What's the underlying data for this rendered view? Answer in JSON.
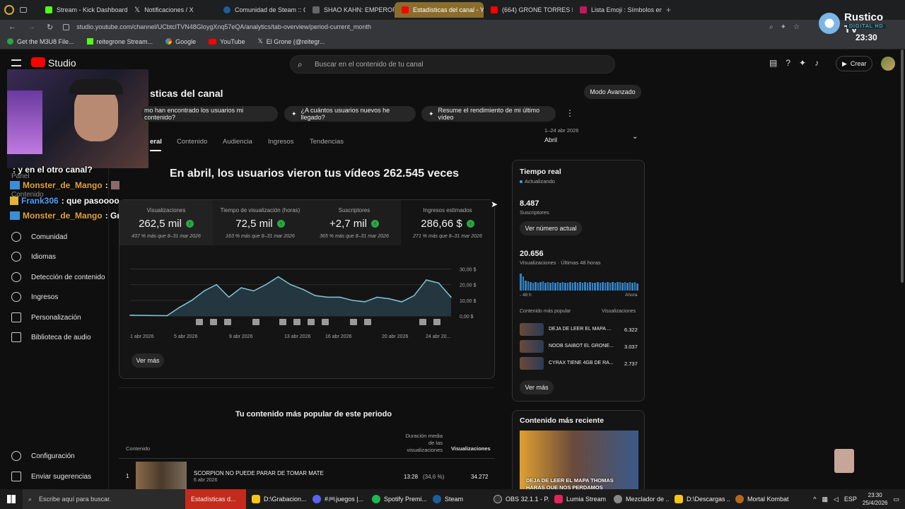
{
  "browser": {
    "tabs": [
      "Stream - Kick Dashboard",
      "Notificaciones / X",
      "Comunidad de Steam :: Gr",
      "SHAO KAHN: EMPEROR O",
      "Estadísticas del canal - Yo",
      "(664) GRONE TORRES DE",
      "Lista Emoji : Símbolos emo"
    ],
    "url": "studio.youtube.com/channel/UCbtclTVN48GloygXnq57eQA/analytics/tab-overview/period-current_month",
    "bookmarks": [
      "Get the M3U8 File...",
      "reitegrone Stream...",
      "Google",
      "YouTube",
      "El Grone (@reitegr..."
    ]
  },
  "overlay": {
    "brand": "Rustico TV",
    "brand_sub": "DIGITAL HD",
    "clock": "23:30"
  },
  "studio": {
    "logo": "Studio",
    "search_placeholder": "Buscar en el contenido de tu canal",
    "create": "Crear",
    "page_title": "sticas del canal",
    "advanced": "Modo Avanzado",
    "chips": [
      "mo han encontrado los usuarios mi contenido?",
      "¿A cuántos usuarios nuevos he llegado?",
      "Resume el rendimiento de mi último vídeo"
    ],
    "tabs": [
      "eral",
      "Contenido",
      "Audiencia",
      "Ingresos",
      "Tendencias"
    ],
    "date_range": "1–24 abr 2026",
    "date_label": "Abril",
    "headline": "En abril, los usuarios vieron tus vídeos 262.545 veces",
    "metrics": [
      {
        "label": "Visualizaciones",
        "value": "262,5 mil",
        "sub": "437 % más que 8–31 mar 2026"
      },
      {
        "label": "Tiempo de visualización (horas)",
        "value": "72,5 mil",
        "sub": "163 % más que 8–31 mar 2026"
      },
      {
        "label": "Suscriptores",
        "value": "+2,7 mil",
        "sub": "365 % más que 8–31 mar 2026"
      },
      {
        "label": "Ingresos estimados",
        "value": "286,66 $",
        "sub": "271 % más que 8–31 mar 2026"
      }
    ],
    "ver_mas": "Ver más",
    "popular_title": "Tu contenido más popular de este periodo",
    "table_headers": {
      "content": "Contenido",
      "avg": "Duración media de las visualizaciones",
      "views": "Visualizaciones"
    },
    "top_row": {
      "rank": "1",
      "title": "SCORPION NO PUEDE PARAR DE TOMAR MATE",
      "date": "6 abr 2026",
      "duration": "13:28",
      "pct": "(34,6 %)",
      "views": "34.272"
    }
  },
  "chart_data": {
    "type": "area",
    "x": [
      "1 abr 2026",
      "5 abr 2026",
      "9 abr 2026",
      "13 abr 2026",
      "16 abr 2026",
      "20 abr 2026",
      "24 abr 20..."
    ],
    "series": [
      {
        "values": [
          0.5,
          0.4,
          0.3,
          0.2,
          5.5,
          10,
          16,
          20,
          12,
          18,
          16,
          20,
          25,
          20,
          17,
          13,
          12,
          12,
          10,
          9,
          12,
          11,
          9,
          13,
          23,
          21,
          12
        ]
      }
    ],
    "yticks": [
      "0,00 $",
      "10,00 $",
      "20,00 $",
      "30,00 $"
    ],
    "ylim": [
      0,
      32
    ]
  },
  "realtime": {
    "title": "Tiempo real",
    "status": "Actualizando",
    "subs_value": "8.487",
    "subs_label": "Suscriptores",
    "button": "Ver número actual",
    "views_value": "20.656",
    "views_label": "Visualizaciones · Últimas 48 horas",
    "bars": [
      1,
      0.85,
      0.6,
      0.55,
      0.5,
      0.45,
      0.5,
      0.45,
      0.5,
      0.55,
      0.45,
      0.5,
      0.45,
      0.5,
      0.45,
      0.5,
      0.45,
      0.5,
      0.45,
      0.45,
      0.5,
      0.45,
      0.5,
      0.45,
      0.5,
      0.45,
      0.5,
      0.45,
      0.5,
      0.45,
      0.45,
      0.5,
      0.45,
      0.5,
      0.45,
      0.5,
      0.45,
      0.5,
      0.45,
      0.5,
      0.5,
      0.45,
      0.5,
      0.45,
      0.5,
      0.45,
      0.5,
      0.4
    ],
    "bar_left": "- 48 h",
    "bar_right": "Ahora",
    "popular_label": "Contenido más popular",
    "popular_views_label": "Visualizaciones",
    "items": [
      {
        "title": "DEJA DE LEER EL MAPA ...",
        "views": "6.322"
      },
      {
        "title": "NOOB SAIBOT EL GRONE...",
        "views": "3.037"
      },
      {
        "title": "CYRAX TIENE 4GB DE RA...",
        "views": "2.737"
      }
    ],
    "ver_mas": "Ver más",
    "recent_title": "Contenido más reciente",
    "recent_caption": "DEJA DE LEER EL MAPA THOMAS HARAS QUE NOS PERDAMOS"
  },
  "sidebar": [
    "Comunidad",
    "Idiomas",
    "Detección de contenido",
    "Ingresos",
    "Personalización",
    "Biblioteca de audio"
  ],
  "sidebar_bottom": [
    "Configuración",
    "Enviar sugerencias"
  ],
  "sidebar_faded": [
    "Panel",
    "Contenido"
  ],
  "chat": [
    {
      "user": "",
      "msg": ": y en el otro canal?"
    },
    {
      "user": "Monster_de_Mango",
      "msg": ":"
    },
    {
      "user": "Frank306",
      "msg": ": que pasoooo"
    },
    {
      "user": "Monster_de_Mango",
      "msg": ": Gracia"
    }
  ],
  "taskbar": {
    "search": "Escribe aquí para buscar.",
    "apps": [
      "Estadísticas d...",
      "D:\\Grabacion...",
      "#🎮juegos |...",
      "Spotify Premi...",
      "Steam",
      "OBS 32.1.1 - P...",
      "Lumia Stream",
      "Mezclador de ...",
      "D:\\Descargas ...",
      "Mortal Kombat"
    ],
    "lang": "ESP",
    "time": "23:30",
    "date": "25/4/2026"
  },
  "colors": {
    "accent": "#3ea6ff",
    "up": "#2ba640",
    "kick": "#53fc18",
    "youtube": "#ff0000"
  }
}
